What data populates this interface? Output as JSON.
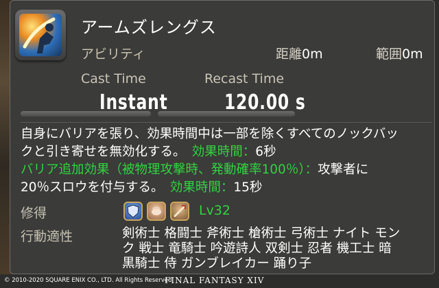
{
  "action": {
    "name": "アームズレングス",
    "category": "アビリティ",
    "range_label": "距離",
    "range_value": "0m",
    "radius_label": "範囲",
    "radius_value": "0m",
    "cast_time_label": "Cast Time",
    "cast_time_value": "Instant",
    "recast_time_label": "Recast Time",
    "recast_time_value": "120.00 s",
    "icon": "arms-length-icon"
  },
  "description": {
    "line1": "自身にバリアを張り、効果時間中は一部を除くすべてのノックバッ",
    "line2_text": "クと引き寄せを無効化する。",
    "line2_green": "効果時間：",
    "line2_val": "6秒",
    "line3_green": "バリア追加効果（被物理攻撃時、発動確率100％）：",
    "line3_text": "攻撃者に",
    "line4_text": "20％スロウを付与する。",
    "line4_green": "効果時間：",
    "line4_val": "15秒"
  },
  "acquire": {
    "label": "修得",
    "level": "Lv32",
    "role_icons": [
      "tank-role-icon",
      "healer-role-icon",
      "dps-role-icon"
    ]
  },
  "jobs": {
    "label": "行動適性",
    "line1": "剣術士 格闘士 斧術士 槍術士 弓術士 ナイト モン",
    "line2": "ク 戦士 竜騎士 吟遊詩人 双剣士 忍者 機工士 暗",
    "line3": "黒騎士 侍 ガンブレイカー 踊り子"
  },
  "footer": {
    "copyright": "© 2010-2020 SQUARE ENIX CO., LTD. All Rights Reserved.",
    "logo": "FINAL FANTASY XIV"
  },
  "colors": {
    "green": "#31d33e",
    "panel": "#3b3b3a"
  }
}
